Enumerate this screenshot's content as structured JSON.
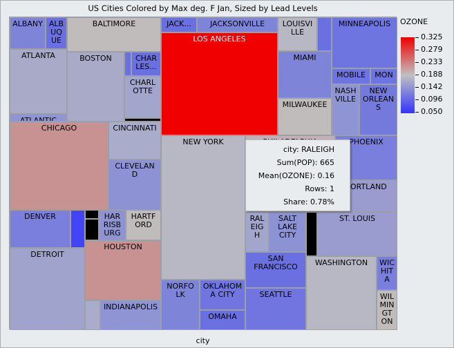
{
  "chart_data": {
    "type": "treemap",
    "title": "US Cities Colored by Max deg. F Jan, Sized by Lead Levels",
    "xlabel": "city",
    "color_legend": {
      "title": "OZONE",
      "ticks": [
        "0.325",
        "0.279",
        "0.233",
        "0.188",
        "0.142",
        "0.096",
        "0.050"
      ],
      "colors": {
        "high": "#f00000",
        "mid": "#c0c0c0",
        "low": "#3333ff"
      }
    },
    "cells": [
      {
        "label": "ALBANY",
        "color": "#7e84d8"
      },
      {
        "label": "ALB\nUQ\nUE",
        "color": "#6a70e0"
      },
      {
        "label": "BALTIMORE",
        "color": "#c0bcbc"
      },
      {
        "label": "ATLANTA",
        "color": "#a8aac8"
      },
      {
        "label": "ATLANTIC",
        "color": "#8f94d4"
      },
      {
        "label": "BOSTON",
        "color": "#a8aac8"
      },
      {
        "label": "",
        "color": "#6a70e0"
      },
      {
        "label": "CHAR\nLES...",
        "color": "#6a70e0"
      },
      {
        "label": "CHARL\nOTTE",
        "color": "#a2a6cc"
      },
      {
        "label": "",
        "color": "#000000"
      },
      {
        "label": "CHICAGO",
        "color": "#c99292"
      },
      {
        "label": "CINCINNATI",
        "color": "#aaaccb"
      },
      {
        "label": "CLEVELAN\nD",
        "color": "#8d92d4"
      },
      {
        "label": "DENVER",
        "color": "#7a7edc"
      },
      {
        "label": "",
        "color": "#4343f8"
      },
      {
        "label": "",
        "color": "#000000"
      },
      {
        "label": "",
        "color": "#000000"
      },
      {
        "label": "HAR\nRISB\nURG",
        "color": "#8f94d0"
      },
      {
        "label": "HARTF\nORD",
        "color": "#c0bcbc"
      },
      {
        "label": "DETROIT",
        "color": "#a0a4cc"
      },
      {
        "label": "HOUSTON",
        "color": "#c99292"
      },
      {
        "label": "",
        "color": "#aaaccb"
      },
      {
        "label": "INDIANAPOLIS",
        "color": "#8f94d4"
      },
      {
        "label": "JACK...",
        "color": "#6a70e0"
      },
      {
        "label": "JACKSONVILLE",
        "color": "#7e84d8"
      },
      {
        "label": "LOS ANGELES",
        "color": "#f00000"
      },
      {
        "label": "LOUISVI\nLLE",
        "color": "#b8b8c4"
      },
      {
        "label": "",
        "color": "#6a70e0"
      },
      {
        "label": "MIAMI",
        "color": "#7e84d8"
      },
      {
        "label": "MILWAUKEE",
        "color": "#c0bcbc"
      },
      {
        "label": "MINNEAPOLIS",
        "color": "#6e74e0"
      },
      {
        "label": "MOBILE",
        "color": "#6e74e0"
      },
      {
        "label": "MON",
        "color": "#6e74e0"
      },
      {
        "label": "NASH\nVILLE",
        "color": "#8f94d4"
      },
      {
        "label": "NEW\nORLEAN\nS",
        "color": "#7479dc"
      },
      {
        "label": "NEW YORK",
        "color": "#b8b8c4"
      },
      {
        "label": "NORFO\nLK",
        "color": "#7e84d8"
      },
      {
        "label": "OKLAHOM\nA CITY",
        "color": "#7075e0"
      },
      {
        "label": "OMAHA",
        "color": "#6a70e0"
      },
      {
        "label": "PHILADELPHIA",
        "color": "#c4b0b4"
      },
      {
        "label": "PHOENIX",
        "color": "#7a7edc"
      },
      {
        "label": "PORTLAND",
        "color": "#9a9cd0"
      },
      {
        "label": "RAL\nEIG\nH",
        "color": "#a2a6cc"
      },
      {
        "label": "SALT\nLAKE\nCITY",
        "color": "#8d92d4"
      },
      {
        "label": "SAN\nFRANCISCO",
        "color": "#6a70e0"
      },
      {
        "label": "SEATTLE",
        "color": "#7075e0"
      },
      {
        "label": "",
        "color": "#000000"
      },
      {
        "label": "ST. LOUIS",
        "color": "#9a9cd0"
      },
      {
        "label": "WASHINGTON",
        "color": "#b8b8c4"
      },
      {
        "label": "WIC\nHIT\nA",
        "color": "#7a7edc"
      },
      {
        "label": "WIL\nMIN\nGT\nON",
        "color": "#c0bcbc"
      }
    ]
  },
  "tooltip": {
    "rows": [
      "city: RALEIGH",
      "Sum(POP): 665",
      "Mean(OZONE): 0.16",
      "Rows: 1",
      "Share: 0.78%"
    ]
  }
}
